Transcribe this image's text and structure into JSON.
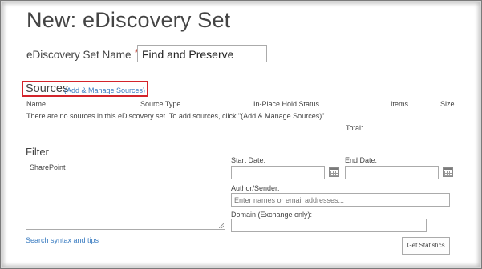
{
  "page": {
    "title": "New: eDiscovery Set"
  },
  "set_name": {
    "label": "eDiscovery Set Name",
    "required_mark": "*",
    "value": "Find and Preserve"
  },
  "sources": {
    "title": "Sources",
    "manage_link": "(Add & Manage Sources)",
    "columns": [
      "Name",
      "Source Type",
      "In-Place Hold Status",
      "Items",
      "Size"
    ],
    "empty_message": "There are no sources in this eDiscovery set. To add sources, click \"(Add & Manage Sources)\".",
    "total_label": "Total:"
  },
  "filter": {
    "title": "Filter",
    "query_value": "SharePoint",
    "start_date_label": "Start Date:",
    "end_date_label": "End Date:",
    "author_label": "Author/Sender:",
    "author_placeholder": "Enter names or email addresses...",
    "domain_label": "Domain (Exchange only):",
    "search_tips_link": "Search syntax and tips",
    "stats_button": "Get Statistics"
  },
  "icons": {
    "start_date_picker": "calendar-icon",
    "end_date_picker": "calendar-icon"
  },
  "colors": {
    "highlight_border": "#d3242b",
    "link": "#3a7cc1",
    "required": "#c0392b"
  }
}
